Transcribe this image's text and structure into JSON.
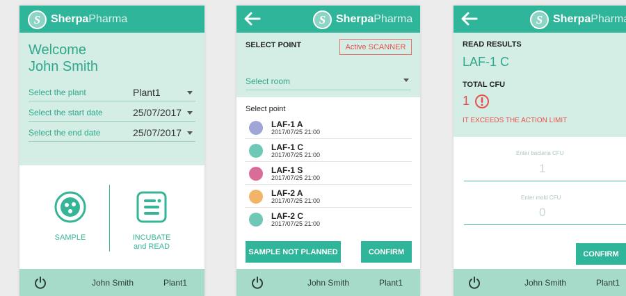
{
  "brand": {
    "name_bold": "Sherpa",
    "name_light": "Pharma"
  },
  "footer": {
    "user": "John Smith",
    "plant": "Plant1"
  },
  "home": {
    "welcome_line1": "Welcome",
    "welcome_line2": "John Smith",
    "fields": [
      {
        "label": "Select the plant",
        "value": "Plant1"
      },
      {
        "label": "Select the start date",
        "value": "25/07/2017"
      },
      {
        "label": "Select the end date",
        "value": "25/07/2017"
      }
    ],
    "actions": [
      {
        "label": "SAMPLE"
      },
      {
        "label_line1": "INCUBATE",
        "label_line2": "and READ"
      }
    ]
  },
  "select_point": {
    "title": "SELECT POINT",
    "scanner_button": "Active SCANNER",
    "room_placeholder": "Select room",
    "points_title": "Select point",
    "points": [
      {
        "name": "LAF-1 A",
        "time": "2017/07/25   21:00",
        "color": "#a1a4d6"
      },
      {
        "name": "LAF-1 C",
        "time": "2017/07/25   21:00",
        "color": "#6fc8b5"
      },
      {
        "name": "LAF-1 S",
        "time": "2017/07/25   21:00",
        "color": "#d86d9a"
      },
      {
        "name": "LAF-2 A",
        "time": "2017/07/25   21:00",
        "color": "#f2b466"
      },
      {
        "name": "LAF-2 C",
        "time": "2017/07/25   21:00",
        "color": "#6fc8b5"
      }
    ],
    "not_planned_button": "SAMPLE NOT PLANNED",
    "confirm_button": "CONFIRM"
  },
  "read_results": {
    "title": "READ RESULTS",
    "point": "LAF-1 C",
    "total_label": "TOTAL CFU",
    "total_value": "1",
    "warning": "IT EXCEEDS THE ACTION LIMIT",
    "bacteria_label": "Enter bacteria CFU",
    "bacteria_value": "1",
    "mold_label": "Enter mold CFU",
    "mold_value": "0",
    "confirm_button": "CONFIRM"
  },
  "colors": {
    "primary": "#2fb59a",
    "panel": "#d4ede5",
    "footer": "#a7dbc9",
    "alert": "#e8514b",
    "accent": "#2fa88b"
  }
}
